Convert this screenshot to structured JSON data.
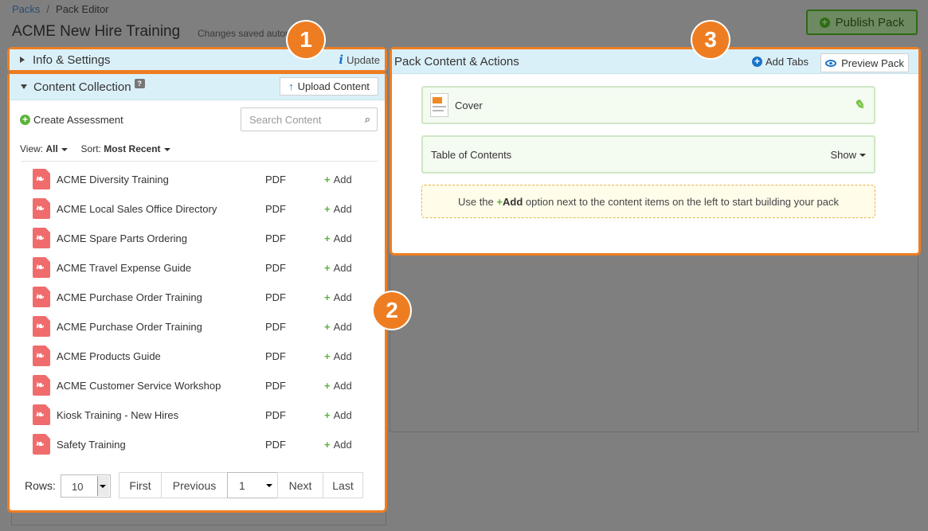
{
  "breadcrumb": {
    "root": "Packs",
    "current": "Pack Editor"
  },
  "page": {
    "title": "ACME New Hire Training",
    "status": "Changes saved automatically"
  },
  "publish": {
    "label": "Publish Pack"
  },
  "info_panel": {
    "title": "Info & Settings",
    "update_label": "Update"
  },
  "collection": {
    "title": "Content Collection",
    "help": "?",
    "upload_label": "Upload Content",
    "create_assessment_label": "Create Assessment",
    "search_placeholder": "Search Content",
    "view_label": "View:",
    "view_value": "All",
    "sort_label": "Sort:",
    "sort_value": "Most Recent",
    "add_label": "Add",
    "items": [
      {
        "name": "ACME Diversity Training",
        "type": "PDF"
      },
      {
        "name": "ACME Local Sales Office Directory",
        "type": "PDF"
      },
      {
        "name": "ACME Spare Parts Ordering",
        "type": "PDF"
      },
      {
        "name": "ACME Travel Expense Guide",
        "type": "PDF"
      },
      {
        "name": "ACME Purchase Order Training",
        "type": "PDF"
      },
      {
        "name": "ACME Purchase Order Training",
        "type": "PDF"
      },
      {
        "name": "ACME Products Guide",
        "type": "PDF"
      },
      {
        "name": "ACME Customer Service Workshop",
        "type": "PDF"
      },
      {
        "name": "Kiosk Training - New Hires",
        "type": "PDF"
      },
      {
        "name": "Safety Training",
        "type": "PDF"
      }
    ],
    "pager": {
      "rows_label": "Rows:",
      "rows_value": "10",
      "first": "First",
      "previous": "Previous",
      "page": "1",
      "next": "Next",
      "last": "Last"
    }
  },
  "pack_panel": {
    "title": "Pack Content & Actions",
    "add_tabs_label": "Add Tabs",
    "preview_label": "Preview Pack",
    "cover_label": "Cover",
    "toc_label": "Table of Contents",
    "toc_action": "Show",
    "notice_prefix": "Use the ",
    "notice_add": "Add",
    "notice_suffix": " option next to the content items on the left to start building your pack"
  },
  "callouts": [
    "1",
    "2",
    "3"
  ],
  "colors": {
    "highlight": "#ee7d22",
    "accent": "#1a73c8",
    "green": "#5bb33c",
    "panel_header": "#daf0f8"
  }
}
